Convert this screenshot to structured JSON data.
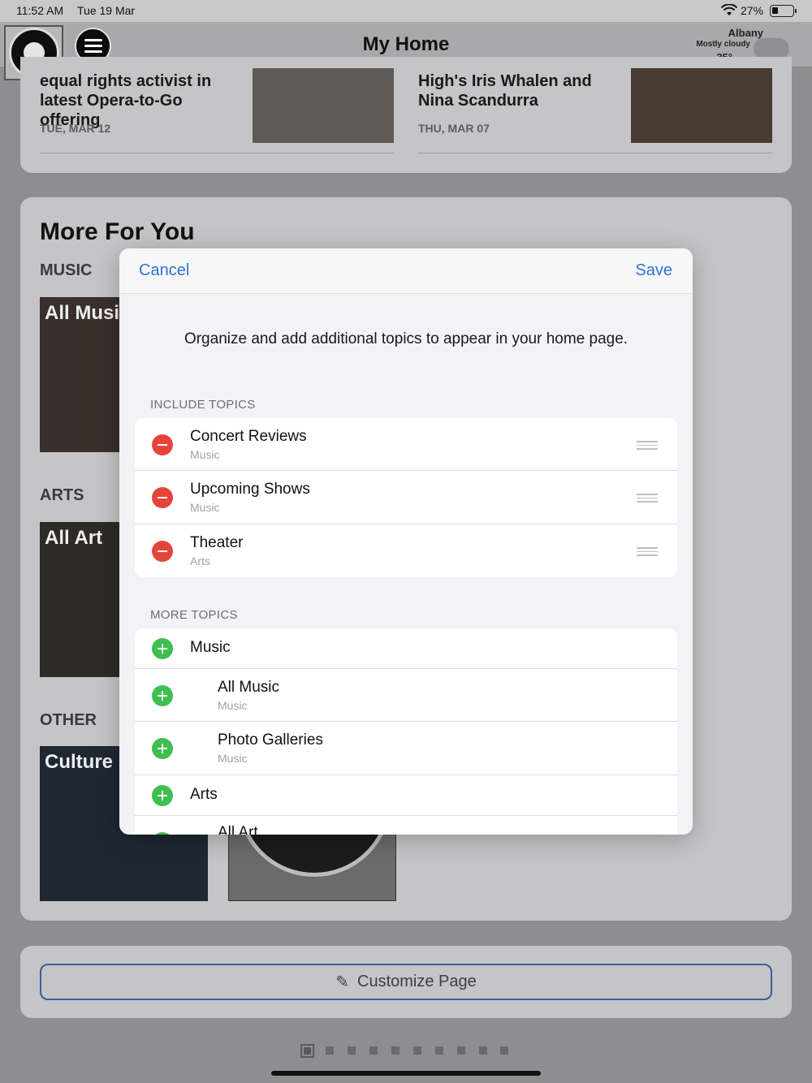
{
  "status_bar": {
    "time": "11:52 AM",
    "date": "Tue 19 Mar",
    "battery": "27%"
  },
  "nav": {
    "title": "My Home",
    "weather": {
      "city": "Albany",
      "condition": "Mostly cloudy",
      "temp": "35°"
    }
  },
  "news": [
    {
      "headline": "equal rights activist in latest Opera-to-Go offering",
      "date": "TUE, MAR 12"
    },
    {
      "headline": "High's Iris Whalen and Nina Scandurra",
      "date": "THU, MAR 07"
    }
  ],
  "more_for_you": {
    "title": "More For You",
    "sections": [
      {
        "label": "MUSIC",
        "tile": "All Music"
      },
      {
        "label": "ARTS",
        "tile": "All Art"
      },
      {
        "label": "OTHER",
        "tile": "Culture"
      }
    ]
  },
  "customize_label": "Customize Page",
  "modal": {
    "cancel": "Cancel",
    "save": "Save",
    "intro": "Organize and add additional topics to appear in your home page.",
    "include_label": "INCLUDE TOPICS",
    "include": [
      {
        "title": "Concert Reviews",
        "sub": "Music"
      },
      {
        "title": "Upcoming Shows",
        "sub": "Music"
      },
      {
        "title": "Theater",
        "sub": "Arts"
      }
    ],
    "more_label": "MORE TOPICS",
    "more": [
      {
        "title": "Music",
        "sub": ""
      },
      {
        "title": "All Music",
        "sub": "Music"
      },
      {
        "title": "Photo Galleries",
        "sub": "Music"
      },
      {
        "title": "Arts",
        "sub": ""
      },
      {
        "title": "All Art",
        "sub": ""
      }
    ]
  },
  "colors": {
    "accent": "#2f73d8",
    "remove": "#e5443a",
    "add": "#3fbf4f"
  }
}
